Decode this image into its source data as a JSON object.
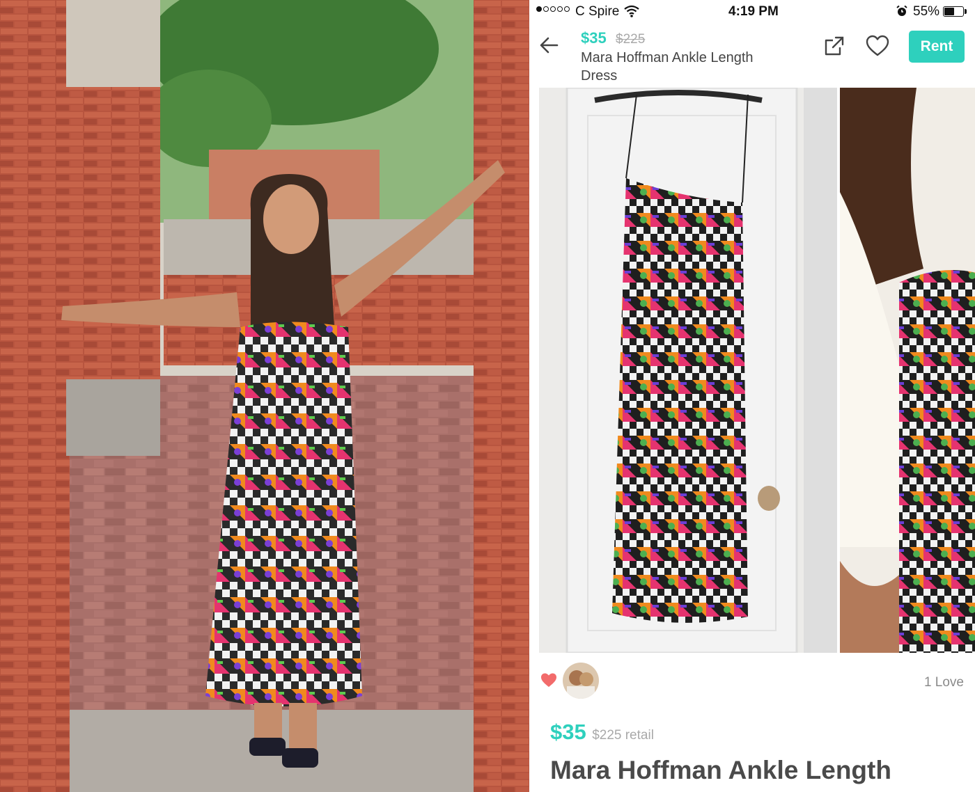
{
  "status_bar": {
    "carrier": "C Spire",
    "time": "4:19 PM",
    "battery_percent": "55%",
    "battery_level": 0.55,
    "signal_bars": 1,
    "signal_total": 5,
    "wifi_icon": "wifi-icon",
    "alarm_icon": "alarm-clock-icon"
  },
  "header": {
    "price": "$35",
    "retail": "$225",
    "title": "Mara Hoffman Ankle Length Dress",
    "back_icon": "arrow-left-icon",
    "share_icon": "share-external-icon",
    "favorite_icon": "heart-outline-icon",
    "rent_label": "Rent"
  },
  "loves": {
    "heart_icon": "heart-filled-icon",
    "count_label": "1 Love"
  },
  "listing": {
    "price": "$35",
    "retail": "$225 retail",
    "title": "Mara Hoffman Ankle Length"
  },
  "colors": {
    "accent": "#2ed0bd",
    "heart": "#f26b6b",
    "text": "#4a4a4a",
    "muted": "#a9a9a9"
  }
}
